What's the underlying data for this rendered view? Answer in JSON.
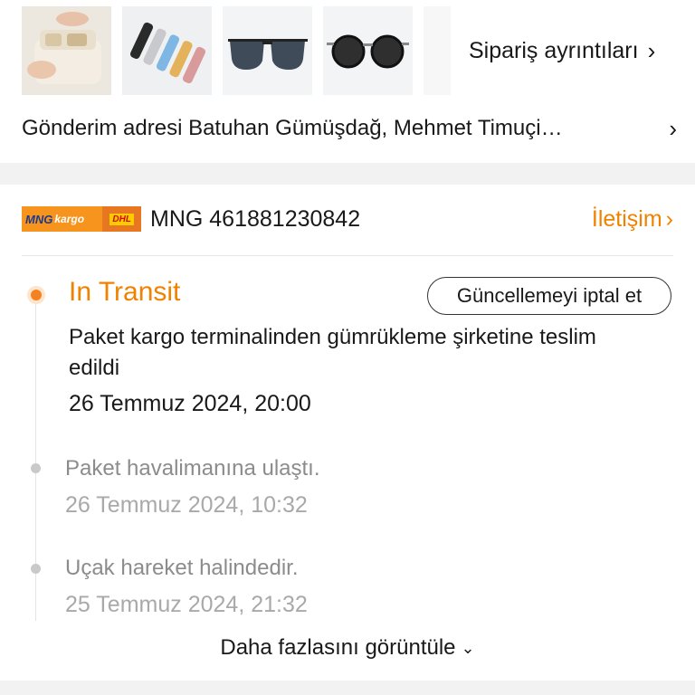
{
  "order": {
    "details_label": "Sipariş ayrıntıları",
    "address_label": "Gönderim adresi Batuhan Gümüşdağ, Mehmet Timuçi…"
  },
  "carrier": {
    "logo_text_mng": "MNG",
    "logo_text_kargo": "kargo",
    "logo_text_dhl": "DHL",
    "tracking": "MNG 461881230842",
    "contact_label": "İletişim"
  },
  "tracking_events": {
    "current_status": "In Transit",
    "cancel_button": "Güncellemeyi iptal et",
    "latest_desc": "Paket kargo terminalinden gümrükleme şirketine teslim edildi",
    "latest_time": "26 Temmuz 2024, 20:00",
    "events": [
      {
        "desc": "Paket havalimanına ulaştı.",
        "time": "26 Temmuz 2024, 10:32"
      },
      {
        "desc": "Uçak hareket halindedir.",
        "time": "25 Temmuz 2024, 21:32"
      }
    ],
    "more_label": "Daha fazlasını görüntüle"
  },
  "icons": {
    "chevron_right": "chevron-right-icon",
    "chevron_down": "chevron-down-icon"
  },
  "colors": {
    "accent": "#f08200",
    "dot_active": "#f58220"
  }
}
